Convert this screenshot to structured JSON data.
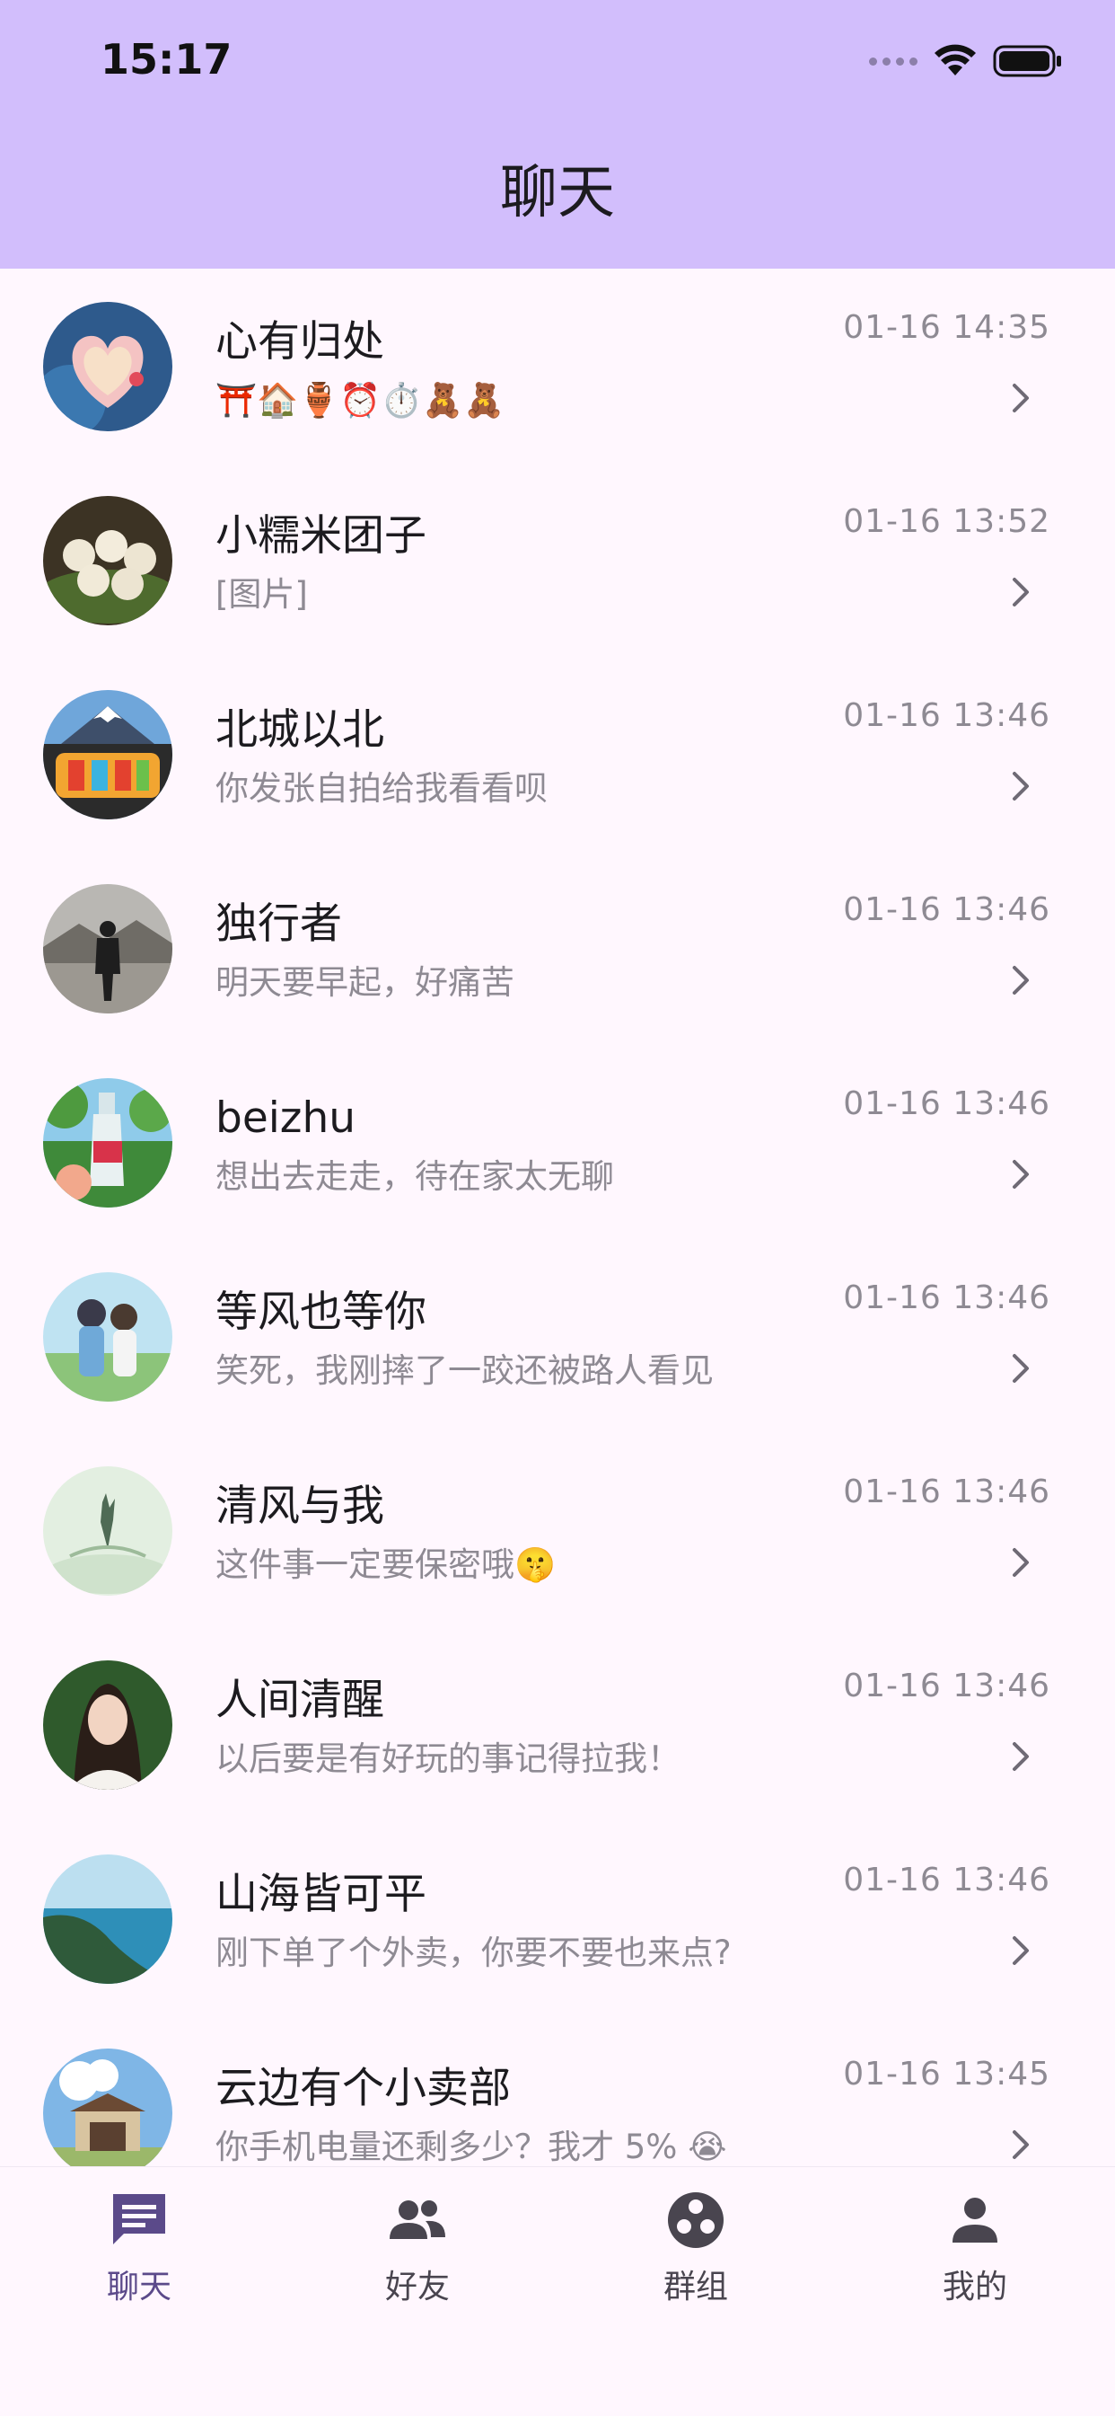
{
  "status_bar": {
    "time": "15:17"
  },
  "header": {
    "title": "聊天"
  },
  "chats": [
    {
      "name": "心有归处",
      "preview": "⛩️🏠🏺⏰⏱️🧸🧸",
      "time": "01-16 14:35",
      "avatar": "heart-art-avatar"
    },
    {
      "name": "小糯米团子",
      "preview": "[图片]",
      "time": "01-16 13:52",
      "avatar": "rice-balls-avatar"
    },
    {
      "name": "北城以北",
      "preview": "你发张自拍给我看看呗",
      "time": "01-16 13:46",
      "avatar": "mountain-graffiti-avatar"
    },
    {
      "name": "独行者",
      "preview": "明天要早起，好痛苦",
      "time": "01-16 13:46",
      "avatar": "lone-man-avatar"
    },
    {
      "name": "beizhu",
      "preview": "想出去走走，待在家太无聊",
      "time": "01-16 13:46",
      "avatar": "soda-bottle-avatar"
    },
    {
      "name": "等风也等你",
      "preview": "笑死，我刚摔了一跤还被路人看见",
      "time": "01-16 13:46",
      "avatar": "couple-avatar"
    },
    {
      "name": "清风与我",
      "preview": "这件事一定要保密哦🤫",
      "time": "01-16 13:46",
      "avatar": "ink-painting-avatar"
    },
    {
      "name": "人间清醒",
      "preview": "以后要是有好玩的事记得拉我！",
      "time": "01-16 13:46",
      "avatar": "woman-portrait-avatar"
    },
    {
      "name": "山海皆可平",
      "preview": "刚下单了个外卖，你要不要也来点?",
      "time": "01-16 13:46",
      "avatar": "coast-avatar"
    },
    {
      "name": "云边有个小卖部",
      "preview": "你手机电量还剩多少？我才 5% 😭",
      "time": "01-16 13:45",
      "avatar": "shop-avatar"
    }
  ],
  "bottom_nav": [
    {
      "label": "聊天",
      "icon": "chat-icon",
      "active": true
    },
    {
      "label": "好友",
      "icon": "friends-icon",
      "active": false
    },
    {
      "label": "群组",
      "icon": "group-icon",
      "active": false
    },
    {
      "label": "我的",
      "icon": "profile-icon",
      "active": false
    }
  ],
  "colors": {
    "header_bg": "#D2BEFC",
    "page_bg": "#FFF7FE",
    "active_nav": "#5B4A8A"
  }
}
